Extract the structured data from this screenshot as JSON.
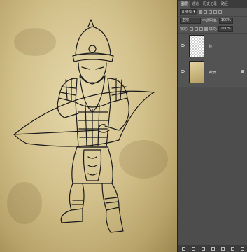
{
  "panel": {
    "tabs": [
      {
        "label": "图层"
      },
      {
        "label": "通道"
      },
      {
        "label": "历史记录"
      },
      {
        "label": "路径"
      }
    ],
    "filter": {
      "kind_label": "类型"
    },
    "blend": {
      "mode": "正常",
      "opacity_label": "不透明度:",
      "opacity_value": "100%"
    },
    "lock": {
      "label": "锁定:",
      "fill_label": "填充:",
      "fill_value": "100%"
    },
    "layers": [
      {
        "name": "线",
        "visible": true,
        "selected": false
      },
      {
        "name": "背景",
        "visible": true,
        "selected": false,
        "locked": true
      }
    ],
    "bottom_icons": [
      "link-icon",
      "fx-icon",
      "mask-icon",
      "adjustment-icon",
      "group-icon",
      "new-layer-icon",
      "trash-icon"
    ]
  },
  "canvas": {
    "theme_color": "#d4c28d",
    "line_color": "#1a1a1a"
  }
}
